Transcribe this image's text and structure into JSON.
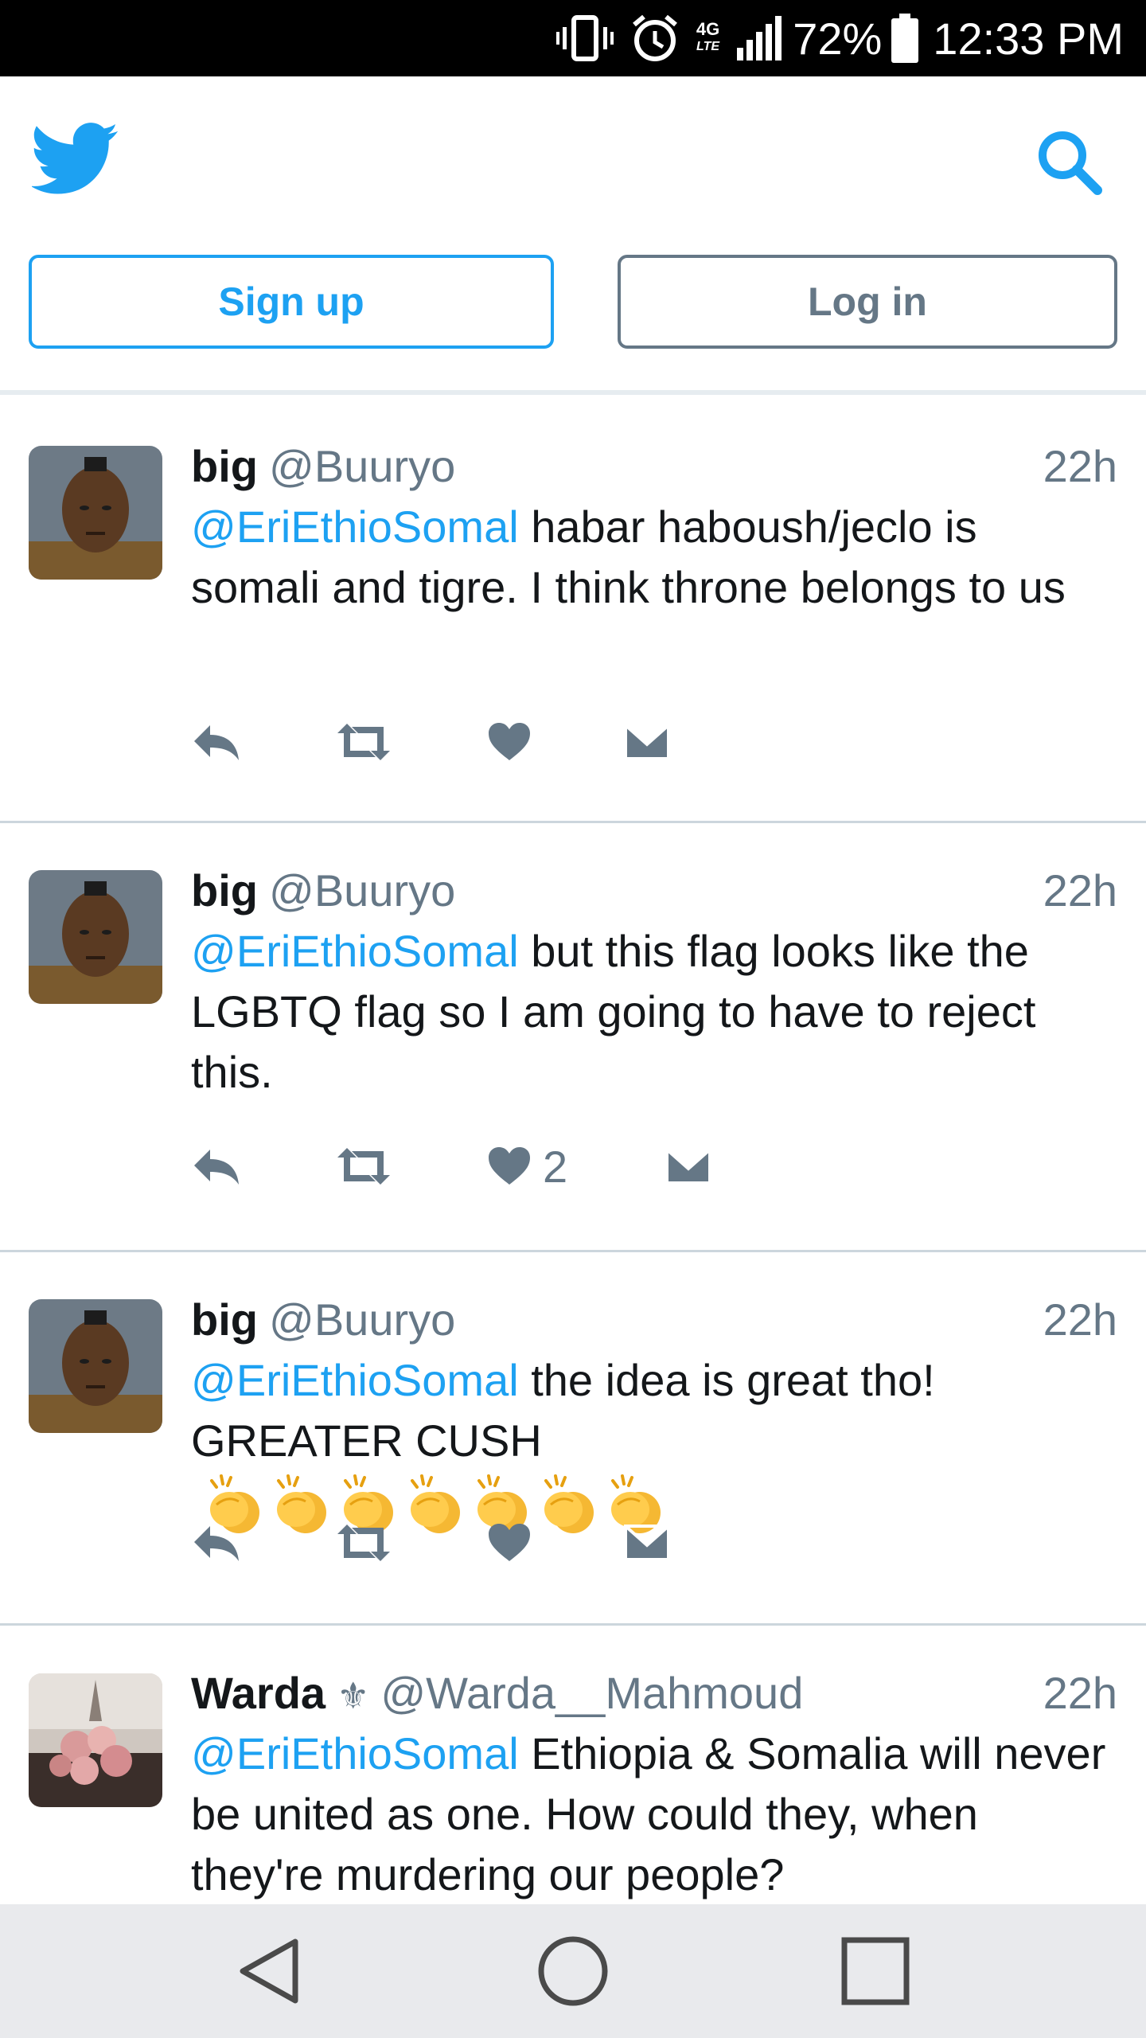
{
  "status_bar": {
    "battery": "72%",
    "time": "12:33 PM",
    "network": "4G",
    "network_sub": "LTE"
  },
  "header": {
    "logo_icon": "twitter-bird-icon",
    "search_icon": "search-icon",
    "signup_label": "Sign up",
    "login_label": "Log in"
  },
  "colors": {
    "brand_blue": "#1da1f2",
    "gray": "#657786",
    "divider": "#ccd6dd"
  },
  "tweets": [
    {
      "name": "big",
      "handle": "@Buuryo",
      "time": "22h",
      "mention": "@EriEthioSomal",
      "text": " habar haboush/jeclo is somali and tigre. I think throne belongs to us",
      "like_count": ""
    },
    {
      "name": "big",
      "handle": "@Buuryo",
      "time": "22h",
      "mention": "@EriEthioSomal",
      "text": " but this flag looks like the LGBTQ flag so I am going to have to reject this.",
      "like_count": "2"
    },
    {
      "name": "big",
      "handle": "@Buuryo",
      "time": "22h",
      "mention": "@EriEthioSomal",
      "text": " the idea is great tho! GREATER CUSH",
      "emoji": "clapping-hands x7",
      "like_count": ""
    },
    {
      "name": "Warda",
      "badge": "⚜",
      "handle": "@Warda__Mahmoud",
      "time": "22h",
      "mention": "@EriEthioSomal",
      "text": " Ethiopia & Somalia will never be united as one. How could they, when they're murdering our people?"
    }
  ],
  "nav_bar": {
    "back_icon": "back-triangle-icon",
    "home_icon": "home-circle-icon",
    "recents_icon": "recents-square-icon"
  }
}
